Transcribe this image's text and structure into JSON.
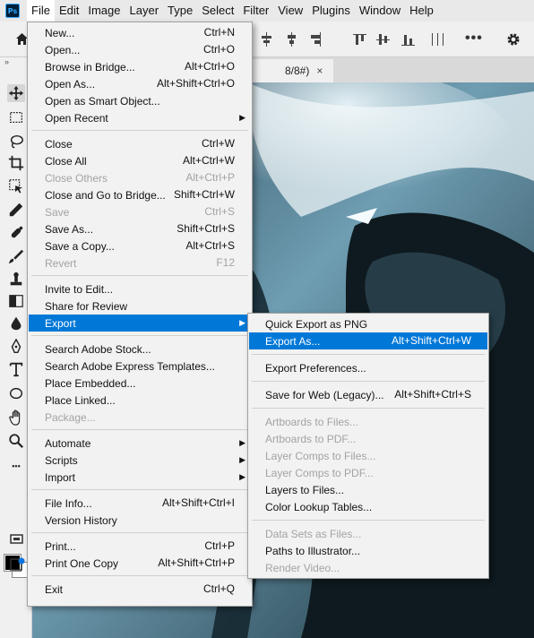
{
  "app": {
    "logo_text": "Ps"
  },
  "menubar": {
    "items": [
      "File",
      "Edit",
      "Image",
      "Layer",
      "Type",
      "Select",
      "Filter",
      "View",
      "Plugins",
      "Window",
      "Help"
    ]
  },
  "document": {
    "tab_title": "8/8#)",
    "close_glyph": "×"
  },
  "tools": {
    "collapse_glyph": "»",
    "more_glyph": "•••"
  },
  "options_bar": {
    "more_glyph": "•••"
  },
  "file_menu": {
    "groups": [
      [
        {
          "label": "New...",
          "shortcut": "Ctrl+N"
        },
        {
          "label": "Open...",
          "shortcut": "Ctrl+O"
        },
        {
          "label": "Browse in Bridge...",
          "shortcut": "Alt+Ctrl+O"
        },
        {
          "label": "Open As...",
          "shortcut": "Alt+Shift+Ctrl+O"
        },
        {
          "label": "Open as Smart Object...",
          "shortcut": ""
        },
        {
          "label": "Open Recent",
          "shortcut": "",
          "submenu": true
        }
      ],
      [
        {
          "label": "Close",
          "shortcut": "Ctrl+W"
        },
        {
          "label": "Close All",
          "shortcut": "Alt+Ctrl+W"
        },
        {
          "label": "Close Others",
          "shortcut": "Alt+Ctrl+P",
          "disabled": true
        },
        {
          "label": "Close and Go to Bridge...",
          "shortcut": "Shift+Ctrl+W"
        },
        {
          "label": "Save",
          "shortcut": "Ctrl+S",
          "disabled": true
        },
        {
          "label": "Save As...",
          "shortcut": "Shift+Ctrl+S"
        },
        {
          "label": "Save a Copy...",
          "shortcut": "Alt+Ctrl+S"
        },
        {
          "label": "Revert",
          "shortcut": "F12",
          "disabled": true
        }
      ],
      [
        {
          "label": "Invite to Edit...",
          "shortcut": ""
        },
        {
          "label": "Share for Review",
          "shortcut": ""
        },
        {
          "label": "Export",
          "shortcut": "",
          "submenu": true,
          "highlighted": true
        }
      ],
      [
        {
          "label": "Search Adobe Stock...",
          "shortcut": ""
        },
        {
          "label": "Search Adobe Express Templates...",
          "shortcut": ""
        },
        {
          "label": "Place Embedded...",
          "shortcut": ""
        },
        {
          "label": "Place Linked...",
          "shortcut": ""
        },
        {
          "label": "Package...",
          "shortcut": "",
          "disabled": true
        }
      ],
      [
        {
          "label": "Automate",
          "shortcut": "",
          "submenu": true
        },
        {
          "label": "Scripts",
          "shortcut": "",
          "submenu": true
        },
        {
          "label": "Import",
          "shortcut": "",
          "submenu": true
        }
      ],
      [
        {
          "label": "File Info...",
          "shortcut": "Alt+Shift+Ctrl+I"
        },
        {
          "label": "Version History",
          "shortcut": ""
        }
      ],
      [
        {
          "label": "Print...",
          "shortcut": "Ctrl+P"
        },
        {
          "label": "Print One Copy",
          "shortcut": "Alt+Shift+Ctrl+P"
        }
      ],
      [
        {
          "label": "Exit",
          "shortcut": "Ctrl+Q"
        }
      ]
    ]
  },
  "export_menu": {
    "groups": [
      [
        {
          "label": "Quick Export as PNG",
          "shortcut": ""
        },
        {
          "label": "Export As...",
          "shortcut": "Alt+Shift+Ctrl+W",
          "highlighted": true
        }
      ],
      [
        {
          "label": "Export Preferences...",
          "shortcut": ""
        }
      ],
      [
        {
          "label": "Save for Web (Legacy)...",
          "shortcut": "Alt+Shift+Ctrl+S"
        }
      ],
      [
        {
          "label": "Artboards to Files...",
          "shortcut": "",
          "disabled": true
        },
        {
          "label": "Artboards to PDF...",
          "shortcut": "",
          "disabled": true
        },
        {
          "label": "Layer Comps to Files...",
          "shortcut": "",
          "disabled": true
        },
        {
          "label": "Layer Comps to PDF...",
          "shortcut": "",
          "disabled": true
        },
        {
          "label": "Layers to Files...",
          "shortcut": ""
        },
        {
          "label": "Color Lookup Tables...",
          "shortcut": ""
        }
      ],
      [
        {
          "label": "Data Sets as Files...",
          "shortcut": "",
          "disabled": true
        },
        {
          "label": "Paths to Illustrator...",
          "shortcut": ""
        },
        {
          "label": "Render Video...",
          "shortcut": "",
          "disabled": true
        }
      ]
    ]
  },
  "colors": {
    "highlight": "#0078d7",
    "disabled_text": "#a3a3a3",
    "menu_bg": "#f2f2f2",
    "menubar_bg": "#e9e9e9"
  },
  "icons": {
    "tools": [
      "move-icon",
      "marquee-icon",
      "lasso-icon",
      "crop-icon",
      "object-select-icon",
      "eyedropper-icon",
      "healing-brush-icon",
      "brush-icon",
      "stamp-icon",
      "gradient-icon",
      "blur-icon",
      "pen-icon",
      "type-icon",
      "shape-icon",
      "hand-icon",
      "zoom-icon"
    ]
  }
}
